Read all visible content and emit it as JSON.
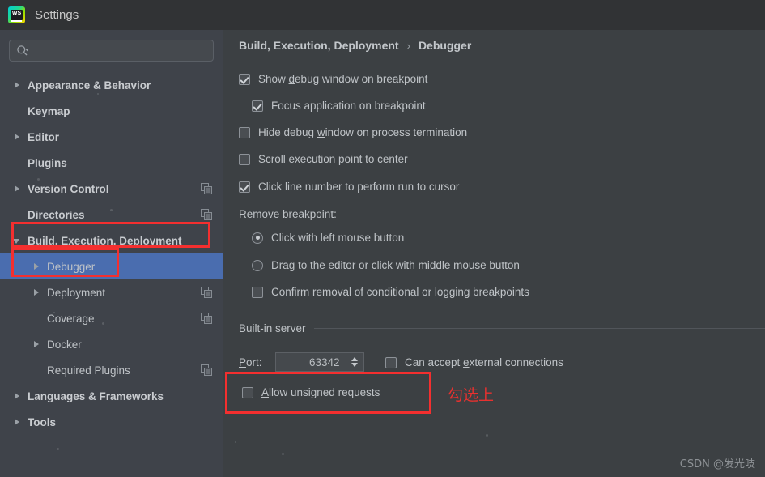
{
  "window": {
    "title": "Settings",
    "logo_icon": "webstorm-logo-icon",
    "logo_text": "WS"
  },
  "search": {
    "value": "",
    "placeholder": "",
    "icon": "search-icon"
  },
  "sidebar": {
    "items": [
      {
        "label": "Appearance & Behavior",
        "arrow": "right",
        "indent": 0,
        "bold": true,
        "selected": false,
        "copy_icon": false
      },
      {
        "label": "Keymap",
        "arrow": "none",
        "indent": 0,
        "bold": true,
        "selected": false,
        "copy_icon": false
      },
      {
        "label": "Editor",
        "arrow": "right",
        "indent": 0,
        "bold": true,
        "selected": false,
        "copy_icon": false
      },
      {
        "label": "Plugins",
        "arrow": "none",
        "indent": 0,
        "bold": true,
        "selected": false,
        "copy_icon": false
      },
      {
        "label": "Version Control",
        "arrow": "right",
        "indent": 0,
        "bold": true,
        "selected": false,
        "copy_icon": true
      },
      {
        "label": "Directories",
        "arrow": "none",
        "indent": 0,
        "bold": true,
        "selected": false,
        "copy_icon": true
      },
      {
        "label": "Build, Execution, Deployment",
        "arrow": "down",
        "indent": 0,
        "bold": true,
        "selected": false,
        "copy_icon": false
      },
      {
        "label": "Debugger",
        "arrow": "right",
        "indent": 1,
        "bold": false,
        "selected": true,
        "copy_icon": false
      },
      {
        "label": "Deployment",
        "arrow": "right",
        "indent": 1,
        "bold": false,
        "selected": false,
        "copy_icon": true
      },
      {
        "label": "Coverage",
        "arrow": "none",
        "indent": 1,
        "bold": false,
        "selected": false,
        "copy_icon": true
      },
      {
        "label": "Docker",
        "arrow": "right",
        "indent": 1,
        "bold": false,
        "selected": false,
        "copy_icon": false
      },
      {
        "label": "Required Plugins",
        "arrow": "none",
        "indent": 1,
        "bold": false,
        "selected": false,
        "copy_icon": true
      },
      {
        "label": "Languages & Frameworks",
        "arrow": "right",
        "indent": 0,
        "bold": true,
        "selected": false,
        "copy_icon": false
      },
      {
        "label": "Tools",
        "arrow": "right",
        "indent": 0,
        "bold": true,
        "selected": false,
        "copy_icon": false
      }
    ]
  },
  "breadcrumb": {
    "parent": "Build, Execution, Deployment",
    "separator": "›",
    "current": "Debugger"
  },
  "options": {
    "show_debug_window": {
      "label": "Show debug window on breakpoint",
      "checked": true
    },
    "focus_application": {
      "label": "Focus application on breakpoint",
      "checked": true
    },
    "hide_debug_window": {
      "label": "Hide debug window on process termination",
      "checked": false
    },
    "scroll_execution_point": {
      "label": "Scroll execution point to center",
      "checked": false
    },
    "click_line_number": {
      "label": "Click line number to perform run to cursor",
      "checked": true
    }
  },
  "remove_breakpoint": {
    "title": "Remove breakpoint:",
    "radio_left_click": {
      "label": "Click with left mouse button",
      "selected": true
    },
    "radio_drag": {
      "label": "Drag to the editor or click with middle mouse button",
      "selected": false
    },
    "confirm_removal": {
      "label": "Confirm removal of conditional or logging breakpoints",
      "checked": false
    }
  },
  "builtin_server": {
    "title": "Built-in server",
    "port_label": "Port:",
    "port_value": "63342",
    "can_accept_external": {
      "label": "Can accept external connections",
      "checked": false
    },
    "allow_unsigned": {
      "label": "Allow unsigned requests",
      "checked": false
    }
  },
  "annotations": {
    "highlight_color": "#f42f2f",
    "note_text": "勾选上",
    "note_color": "#e8312f"
  },
  "watermark": {
    "text": "CSDN @发光吱"
  }
}
